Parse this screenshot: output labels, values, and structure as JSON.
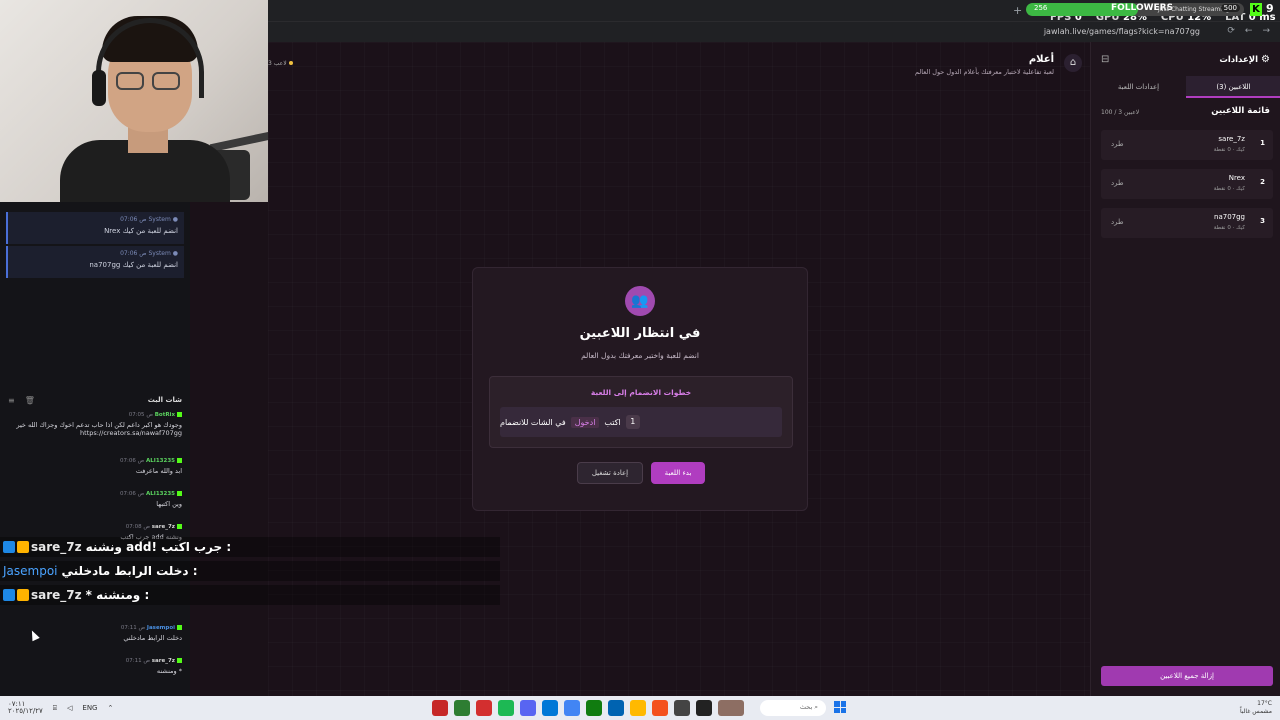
{
  "browser": {
    "url": "jawlah.live/games/flags?kick=na707gg",
    "new_tab": "+",
    "nav_icons": [
      "⟳",
      "←",
      "→"
    ]
  },
  "stats": {
    "fps_label": "FPS",
    "fps_value": "0",
    "gpu_label": "GPU",
    "gpu_value": "28%",
    "cpu_label": "CPU",
    "cpu_value": "12%",
    "lat_label": "LAT",
    "lat_value": "0 ms"
  },
  "followers": {
    "count": "256",
    "title": "FOLLOWERS",
    "subtitle": "Just Chatting Streaming",
    "goal": "500",
    "progress": 0.512,
    "kick_logo": "K",
    "kick_number": "9"
  },
  "colors": {
    "accent": "#b03dc0",
    "kick_green": "#53fc18",
    "system_blue": "#4a6fd8"
  },
  "left_panel": {
    "system_messages": [
      {
        "user": "System",
        "time": "07:06 ص",
        "text": "Nrex انضم للعبة من كيك"
      },
      {
        "user": "System",
        "time": "07:06 ص",
        "text": "na707gg انضم للعبة من كيك"
      }
    ],
    "chat_title": "شات البث",
    "chat_messages": [
      {
        "user": "BotRix",
        "time": "07:05 ص",
        "style": "green",
        "text": "وجودك هو اكبر داعم لكن اذا حاب تدعم اخوك وجزاك الله خير https://creators.sa/nawaf707gg"
      },
      {
        "user": "ALI13235",
        "time": "07:06 ص",
        "style": "green",
        "text": "ابد والله ماعرفت"
      },
      {
        "user": "ALI13235",
        "time": "07:06 ص",
        "style": "green",
        "text": "وين اكتبها"
      },
      {
        "user": "sare_7z",
        "time": "07:08 ص",
        "style": "white",
        "text": "جرب اكتب add ونشنه"
      },
      {
        "user": "Jasempoi",
        "time": "07:11 ص",
        "style": "blue",
        "text": "دخلت الرابط مادخلني"
      },
      {
        "user": "sare_7z",
        "time": "07:11 ص",
        "style": "white",
        "text": "ومنشنه *"
      }
    ]
  },
  "overlay_chat": [
    {
      "user": "sare_7z",
      "text": "ونشنه add! جرب اكتب :"
    },
    {
      "user": "Jasempoi",
      "text": "دخلت الرابط مادخلني :"
    },
    {
      "user": "sare_7z",
      "text": "* ومنشنه :"
    }
  ],
  "game": {
    "title": "أعلام",
    "description": "لعبة تفاعلية لاختبار معرفتك بأعلام الدول حول العالم",
    "home_icon": "⌂",
    "players_count": "3 لاعب"
  },
  "modal": {
    "icon": "users-icon",
    "title": "في انتظار اللاعبين",
    "subtitle": "انضم للعبة واختبر معرفتك بدول العالم",
    "steps_title": "خطوات الانضمام إلى اللعبة",
    "step": {
      "number": "1",
      "prefix": "اكتب",
      "command": "ادخول",
      "suffix": "في الشات للانضمام"
    },
    "reset_label": "إعادة تشغيل",
    "start_label": "بدء اللعبة"
  },
  "settings": {
    "title": "الإعدادات",
    "tabs": [
      {
        "label": "اللاعبين (3)",
        "active": true
      },
      {
        "label": "إعدادات اللعبة",
        "active": false
      }
    ],
    "list_title": "قائمة اللاعبين",
    "count_label": "100 / 3 لاعبين",
    "players": [
      {
        "index": "1",
        "name": "sare_7z",
        "sub": "كيك · 0 نقطة",
        "kick_label": "طرد"
      },
      {
        "index": "2",
        "name": "Nrex",
        "sub": "كيك · 0 نقطة",
        "kick_label": "طرد"
      },
      {
        "index": "3",
        "name": "na707gg",
        "sub": "كيك · 0 نقطة",
        "kick_label": "طرد"
      }
    ],
    "remove_all_label": "إزالة جميع اللاعبين"
  },
  "taskbar": {
    "time": "٠٧:١١",
    "date": "٢٠٢٥/١٢/٢٧",
    "lang": "ENG",
    "search_placeholder": "بحث",
    "weather_temp": "17°C",
    "weather_text": "مشمس غالباً"
  }
}
